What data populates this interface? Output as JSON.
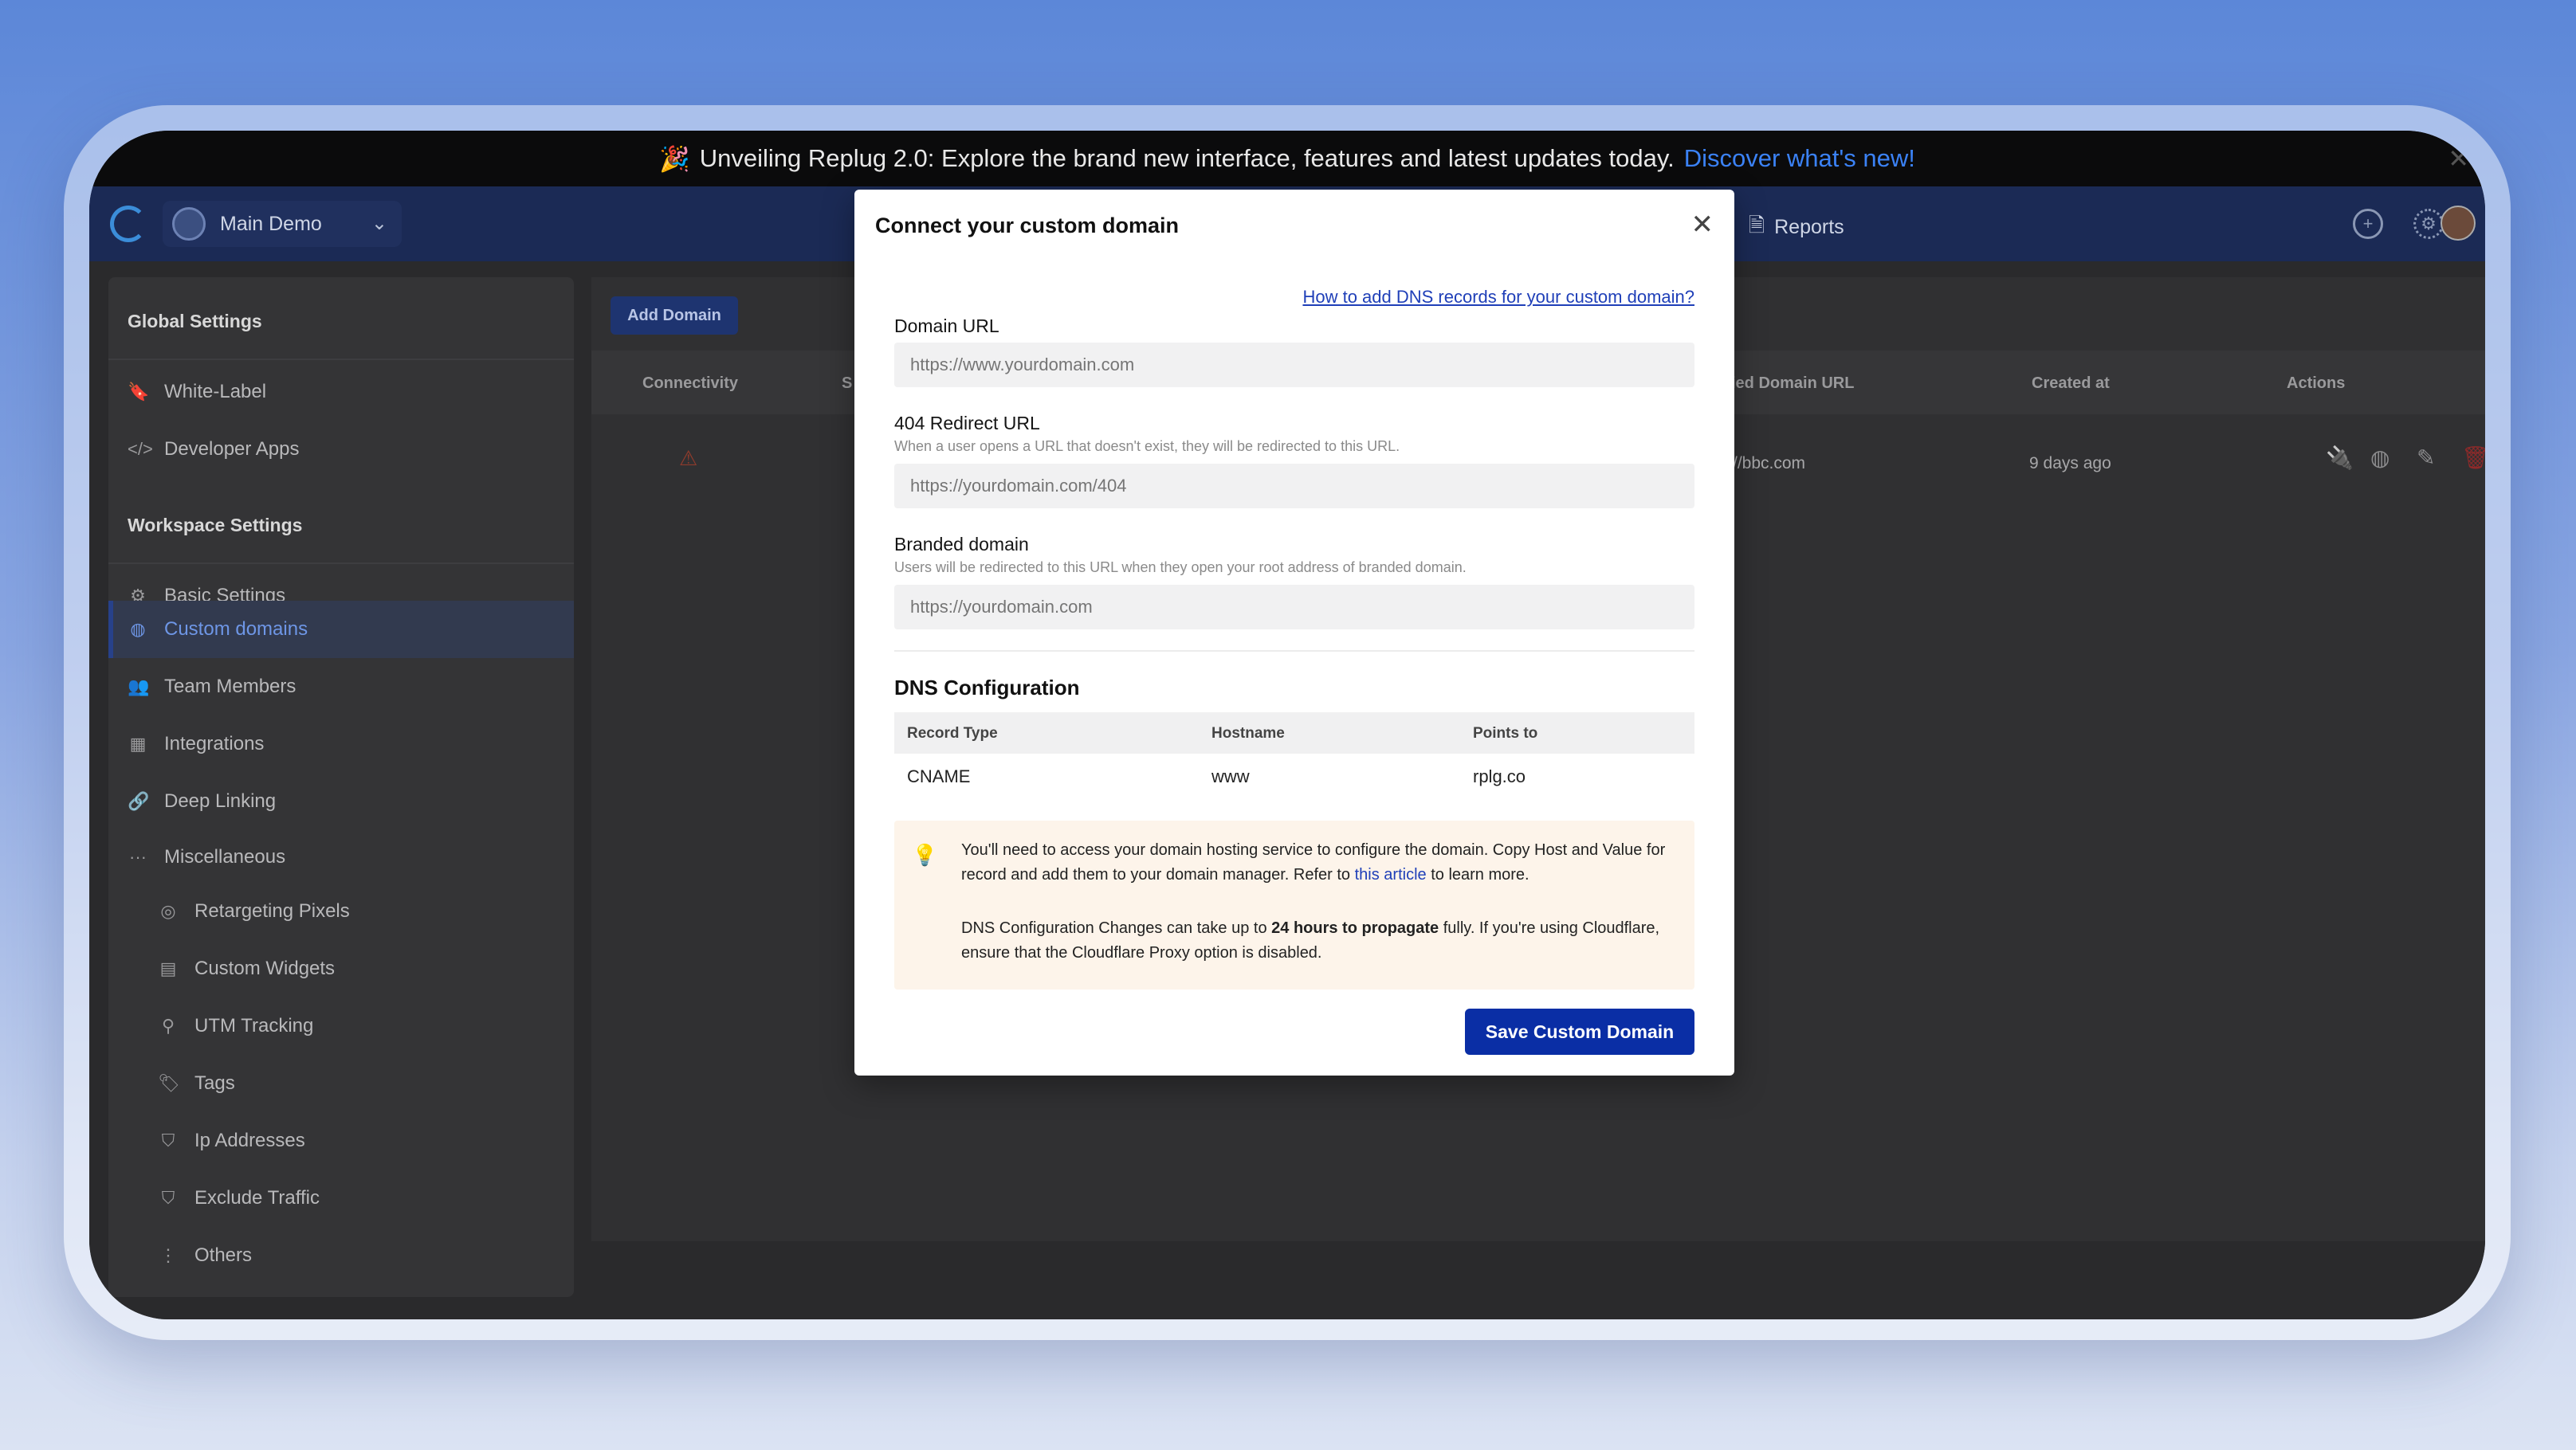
{
  "announcement": {
    "icon": "party-popper-icon",
    "text": "Unveiling Replug 2.0: Explore the brand new interface, features and latest updates today.",
    "link_text": "Discover what's new!"
  },
  "navbar": {
    "workspace_name": "Main Demo",
    "reports_label": "Reports"
  },
  "sidebar": {
    "global_heading": "Global Settings",
    "global_items": [
      {
        "label": "White-Label",
        "icon": "bookmark-icon"
      },
      {
        "label": "Developer Apps",
        "icon": "code-icon"
      }
    ],
    "workspace_heading": "Workspace Settings",
    "workspace_items": [
      {
        "label": "Basic Settings",
        "icon": "gear-icon"
      },
      {
        "label": "Custom domains",
        "icon": "globe-icon",
        "active": true
      },
      {
        "label": "Team Members",
        "icon": "users-icon"
      },
      {
        "label": "Integrations",
        "icon": "blocks-icon"
      },
      {
        "label": "Deep Linking",
        "icon": "link-icon"
      },
      {
        "label": "Miscellaneous",
        "icon": "ellipsis-icon"
      }
    ],
    "misc_items": [
      {
        "label": "Retargeting Pixels",
        "icon": "target-icon"
      },
      {
        "label": "Custom Widgets",
        "icon": "layout-icon"
      },
      {
        "label": "UTM Tracking",
        "icon": "pin-icon"
      },
      {
        "label": "Tags",
        "icon": "tag-icon"
      },
      {
        "label": "Ip Addresses",
        "icon": "shield-icon"
      },
      {
        "label": "Exclude Traffic",
        "icon": "shield-icon"
      },
      {
        "label": "Others",
        "icon": "dots-vertical-icon"
      }
    ]
  },
  "main": {
    "add_domain_label": "Add Domain",
    "columns": {
      "connectivity": "Connectivity",
      "partial": "S",
      "domain_url": "ied Domain URL",
      "created_at": "Created at",
      "actions": "Actions"
    },
    "row": {
      "domain": "//bbc.com",
      "created": "9 days ago"
    }
  },
  "modal": {
    "title": "Connect your custom domain",
    "help_link": "How to add DNS records for your custom domain?",
    "domain_url": {
      "label": "Domain URL",
      "placeholder": "https://www.yourdomain.com"
    },
    "redirect_url": {
      "label": "404 Redirect URL",
      "help": "When a user opens a URL that doesn't exist, they will be redirected to this URL.",
      "placeholder": "https://yourdomain.com/404"
    },
    "branded_domain": {
      "label": "Branded domain",
      "help": "Users will be redirected to this URL when they open your root address of branded domain.",
      "placeholder": "https://yourdomain.com"
    },
    "dns": {
      "title": "DNS Configuration",
      "headers": [
        "Record Type",
        "Hostname",
        "Points to"
      ],
      "row": [
        "CNAME",
        "www",
        "rplg.co"
      ]
    },
    "info": {
      "line1_a": "You'll need to access your domain hosting service to configure the domain. Copy Host and Value for record and add them to your domain manager. Refer to",
      "line1_link": "this article",
      "line1_b": "to learn more.",
      "line2_a": "DNS Configuration Changes can take up to",
      "line2_bold": "24 hours to propagate",
      "line2_b": "fully. If you're using Cloudflare, ensure that the Cloudflare Proxy option is disabled."
    },
    "save_label": "Save Custom Domain"
  }
}
